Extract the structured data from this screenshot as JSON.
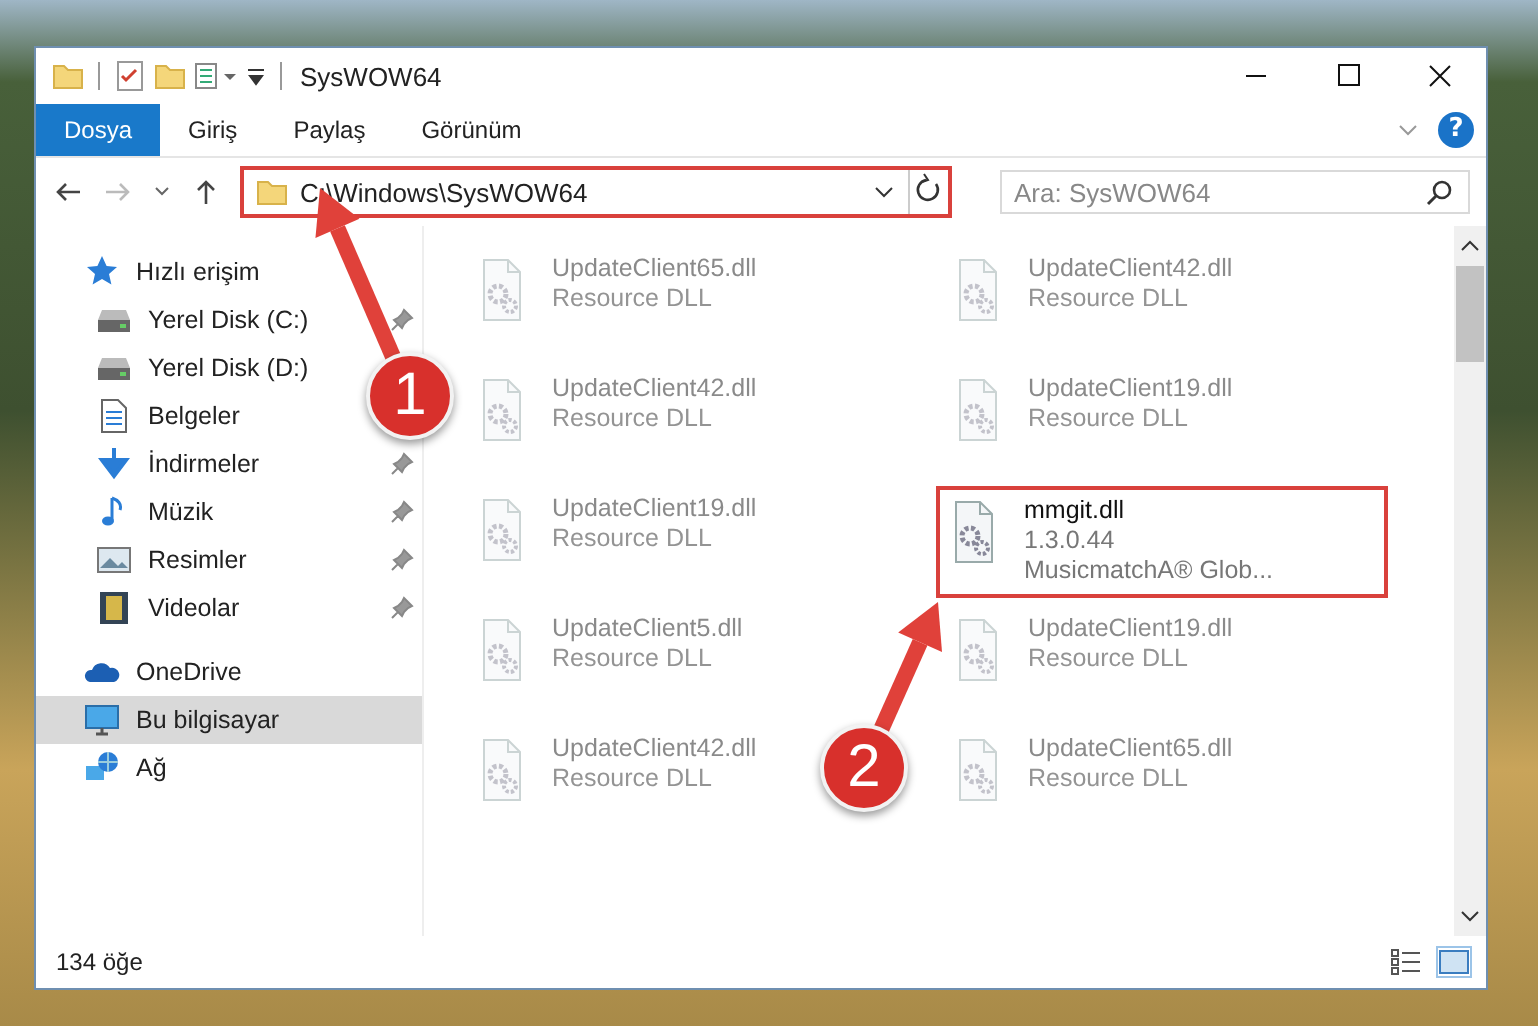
{
  "window": {
    "title": "SysWOW64"
  },
  "ribbon_tabs": [
    {
      "label": "Dosya",
      "selected": true
    },
    {
      "label": "Giriş",
      "selected": false
    },
    {
      "label": "Paylaş",
      "selected": false
    },
    {
      "label": "Görünüm",
      "selected": false
    }
  ],
  "help_button": {
    "label": "?"
  },
  "address_bar": {
    "value": "C:\\Windows\\SysWOW64",
    "highlighted": true
  },
  "search": {
    "placeholder": "Ara: SysWOW64"
  },
  "sidebar": {
    "items": [
      {
        "label": "Hızlı erişim",
        "kind": "star",
        "selected": false,
        "children": [
          {
            "label": "Yerel Disk (C:)",
            "kind": "drive",
            "pinned": true,
            "selected": false
          },
          {
            "label": "Yerel Disk (D:)",
            "kind": "drive",
            "selected": false
          },
          {
            "label": "Belgeler",
            "kind": "document",
            "selected": false
          },
          {
            "label": "İndirmeler",
            "kind": "download",
            "pinned": true,
            "selected": false
          },
          {
            "label": "Müzik",
            "kind": "music",
            "pinned": true,
            "selected": false
          },
          {
            "label": "Resimler",
            "kind": "picture",
            "pinned": true,
            "selected": false
          },
          {
            "label": "Videolar",
            "kind": "video",
            "pinned": true,
            "selected": false
          }
        ]
      },
      {
        "label": "OneDrive",
        "kind": "cloud",
        "selected": false
      },
      {
        "label": "Bu bilgisayar",
        "kind": "computer",
        "selected": true
      },
      {
        "label": "Ağ",
        "kind": "network",
        "selected": false
      }
    ]
  },
  "files": [
    {
      "name": "UpdateClient65.dll",
      "type": "Resource DLL",
      "dimmed": true,
      "highlighted": false
    },
    {
      "name": "UpdateClient42.dll",
      "type": "Resource DLL",
      "dimmed": true,
      "highlighted": false
    },
    {
      "name": "UpdateClient42.dll",
      "type": "Resource DLL",
      "dimmed": true,
      "highlighted": false
    },
    {
      "name": "UpdateClient19.dll",
      "type": "Resource DLL",
      "dimmed": true,
      "highlighted": false
    },
    {
      "name": "UpdateClient19.dll",
      "type": "Resource DLL",
      "dimmed": true,
      "highlighted": false
    },
    {
      "name": "mmgit.dll",
      "version": "1.3.0.44",
      "type": "MusicmatchA® Glob...",
      "dimmed": false,
      "highlighted": true
    },
    {
      "name": "UpdateClient5.dll",
      "type": "Resource DLL",
      "dimmed": true,
      "highlighted": false
    },
    {
      "name": "UpdateClient19.dll",
      "type": "Resource DLL",
      "dimmed": true,
      "highlighted": false
    },
    {
      "name": "UpdateClient42.dll",
      "type": "Resource DLL",
      "dimmed": true,
      "highlighted": false
    },
    {
      "name": "UpdateClient65.dll",
      "type": "Resource DLL",
      "dimmed": true,
      "highlighted": false
    }
  ],
  "status_bar": {
    "item_count": "134 öğe"
  },
  "annotations": [
    {
      "label": "1"
    },
    {
      "label": "2"
    }
  ]
}
